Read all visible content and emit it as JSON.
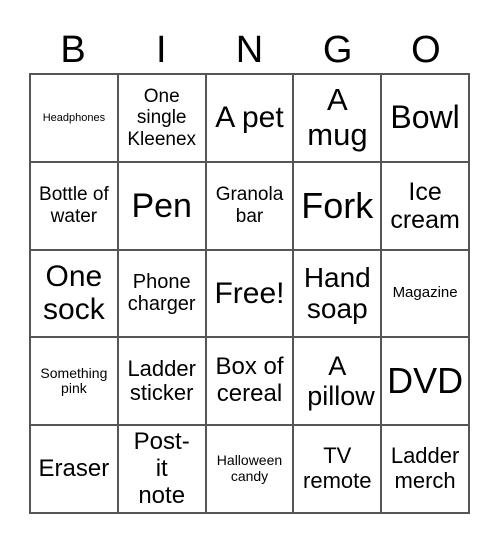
{
  "header": [
    "B",
    "I",
    "N",
    "G",
    "O"
  ],
  "cells": [
    "Headphones",
    "One single Kleenex",
    "A pet",
    "A mug",
    "Bowl",
    "Bottle of water",
    "Pen",
    "Granola bar",
    "Fork",
    "Ice cream",
    "One sock",
    "Phone charger",
    "Free!",
    "Hand soap",
    "Magazine",
    "Something pink",
    "Ladder sticker",
    "Box of cereal",
    "A pillow",
    "DVD",
    "Eraser",
    "Post-it note",
    "Halloween candy",
    "TV remote",
    "Ladder merch"
  ]
}
